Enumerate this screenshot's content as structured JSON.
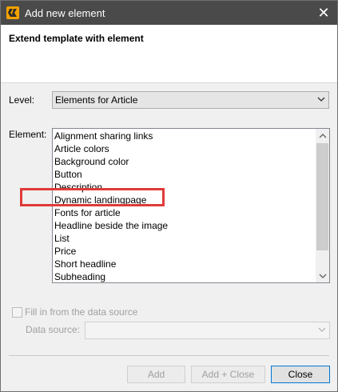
{
  "window": {
    "title": "Add new element",
    "close_glyph": "✕",
    "app_icon": "brand-app-icon",
    "accent_color": "#f5a200"
  },
  "header": {
    "title": "Extend template with element"
  },
  "level": {
    "label": "Level:",
    "selected": "Elements for Article"
  },
  "element": {
    "label": "Element:",
    "items": [
      "Alignment sharing links",
      "Article colors",
      "Background color",
      "Button",
      "Description",
      "Dynamic landingpage",
      "Fonts for article",
      "Headline beside the image",
      "List",
      "Price",
      "Short headline",
      "Subheading"
    ],
    "highlight_color": "#e03a3a"
  },
  "datasource": {
    "checkbox_label": "Fill in from the data source",
    "checked": false,
    "field_label": "Data source:",
    "value": ""
  },
  "buttons": {
    "add": "Add",
    "add_close": "Add + Close",
    "close": "Close"
  }
}
